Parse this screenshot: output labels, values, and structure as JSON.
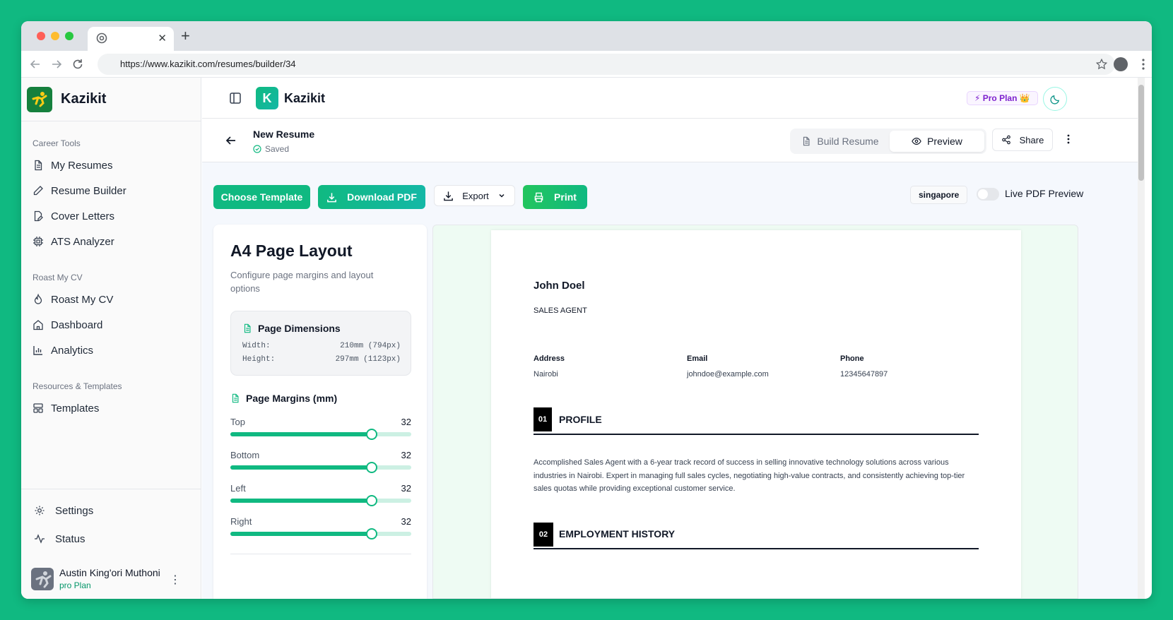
{
  "browser": {
    "url": "https://www.kazikit.com/resumes/builder/34",
    "traffic_colors": [
      "#ff5f57",
      "#febc2e",
      "#28c840"
    ]
  },
  "sidebar": {
    "brand": "Kazikit",
    "sections": [
      {
        "title": "Career Tools",
        "items": [
          {
            "label": "My Resumes",
            "icon": "file-text-icon"
          },
          {
            "label": "Resume Builder",
            "icon": "pen-icon"
          },
          {
            "label": "Cover Letters",
            "icon": "file-edit-icon"
          },
          {
            "label": "ATS Analyzer",
            "icon": "cpu-icon"
          }
        ]
      },
      {
        "title": "Roast My CV",
        "items": [
          {
            "label": "Roast My CV",
            "icon": "flame-icon"
          },
          {
            "label": "Dashboard",
            "icon": "home-icon"
          },
          {
            "label": "Analytics",
            "icon": "bar-chart-icon"
          }
        ]
      },
      {
        "title": "Resources & Templates",
        "items": [
          {
            "label": "Templates",
            "icon": "layout-icon"
          }
        ]
      }
    ],
    "footer": {
      "settings": "Settings",
      "status": "Status",
      "user_name": "Austin King'ori Muthoni",
      "user_plan": "pro Plan"
    }
  },
  "header": {
    "app_name": "Kazikit",
    "logo_letter": "K",
    "plan_badge": "⚡ Pro Plan 👑"
  },
  "docbar": {
    "title": "New Resume",
    "status": "Saved",
    "build_label": "Build Resume",
    "preview_label": "Preview",
    "share_label": "Share"
  },
  "toolbar": {
    "choose_template": "Choose Template",
    "download_pdf": "Download PDF",
    "export": "Export",
    "print": "Print",
    "template_tag": "singapore",
    "live_preview": "Live PDF Preview",
    "live_preview_on": false
  },
  "layout_panel": {
    "title": "A4 Page Layout",
    "subtitle": "Configure page margins and layout options",
    "dimensions": {
      "heading": "Page Dimensions",
      "width_label": "Width:",
      "width_value": "210mm (794px)",
      "height_label": "Height:",
      "height_value": "297mm (1123px)"
    },
    "margins_heading": "Page Margins (mm)",
    "margins": [
      {
        "label": "Top",
        "value": "32",
        "fraction": 0.78
      },
      {
        "label": "Bottom",
        "value": "32",
        "fraction": 0.78
      },
      {
        "label": "Left",
        "value": "32",
        "fraction": 0.78
      },
      {
        "label": "Right",
        "value": "32",
        "fraction": 0.78
      }
    ]
  },
  "resume": {
    "name": "John Doel",
    "job_title": "SALES AGENT",
    "contacts": [
      {
        "label": "Address",
        "value": "Nairobi"
      },
      {
        "label": "Email",
        "value": "johndoe@example.com"
      },
      {
        "label": "Phone",
        "value": "12345647897"
      }
    ],
    "sections": [
      {
        "num": "01",
        "title": "PROFILE"
      },
      {
        "num": "02",
        "title": "EMPLOYMENT HISTORY"
      }
    ],
    "profile_text": "Accomplished Sales Agent with a 6-year track record of success in selling innovative technology solutions across various industries in Nairobi. Expert in managing full sales cycles, negotiating high-value contracts, and consistently achieving top-tier sales quotas while providing exceptional customer service."
  }
}
